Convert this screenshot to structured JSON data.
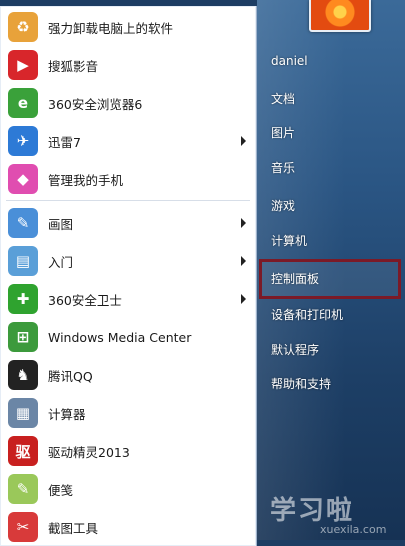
{
  "programs": [
    {
      "label": "强力卸载电脑上的软件",
      "icon": "uninstall-icon",
      "color": "#e8a23a",
      "arrow": false
    },
    {
      "label": "搜狐影音",
      "icon": "sohu-video-icon",
      "color": "#d8262b",
      "arrow": false
    },
    {
      "label": "360安全浏览器6",
      "icon": "360-browser-icon",
      "color": "#3aa13a",
      "arrow": false
    },
    {
      "label": "迅雷7",
      "icon": "xunlei-icon",
      "color": "#2d7ad6",
      "arrow": true
    },
    {
      "label": "管理我的手机",
      "icon": "phone-manager-icon",
      "color": "#e04db0",
      "arrow": false
    },
    {
      "label": "画图",
      "icon": "paint-icon",
      "color": "#4a8fd8",
      "arrow": true
    },
    {
      "label": "入门",
      "icon": "getting-started-icon",
      "color": "#5a9fd8",
      "arrow": true
    },
    {
      "label": "360安全卫士",
      "icon": "360-guard-icon",
      "color": "#2fa32f",
      "arrow": true
    },
    {
      "label": "Windows Media Center",
      "icon": "media-center-icon",
      "color": "#3c9a3c",
      "arrow": false
    },
    {
      "label": "腾讯QQ",
      "icon": "qq-icon",
      "color": "#222222",
      "arrow": false
    },
    {
      "label": "计算器",
      "icon": "calculator-icon",
      "color": "#6b86a6",
      "arrow": false
    },
    {
      "label": "驱动精灵2013",
      "icon": "driver-genius-icon",
      "color": "#c8201f",
      "arrow": false
    },
    {
      "label": "便笺",
      "icon": "sticky-notes-icon",
      "color": "#9ac85a",
      "arrow": false
    },
    {
      "label": "截图工具",
      "icon": "snipping-tool-icon",
      "color": "#d83a3a",
      "arrow": false
    }
  ],
  "icon_glyphs": [
    "♻",
    "▶",
    "e",
    "✈",
    "◆",
    "✎",
    "▤",
    "✚",
    "⊞",
    "♞",
    "▦",
    "驱",
    "✎",
    "✂"
  ],
  "right_items": [
    "daniel",
    "文档",
    "图片",
    "音乐",
    "游戏",
    "计算机",
    "控制面板",
    "设备和打印机",
    "默认程序",
    "帮助和支持"
  ],
  "highlighted_item": "控制面板",
  "watermark": {
    "main": "学习啦",
    "sub": "xuexila.com"
  }
}
